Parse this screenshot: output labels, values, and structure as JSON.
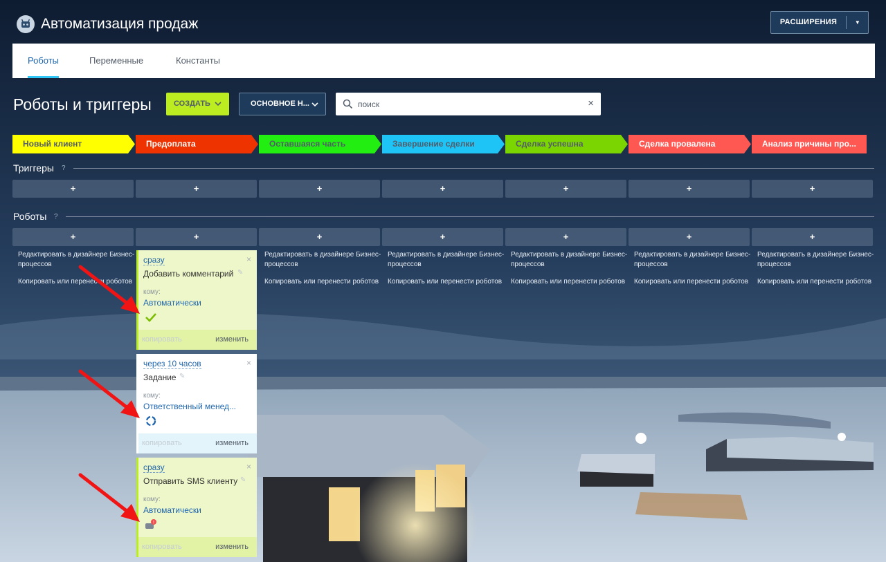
{
  "header": {
    "app_title": "Автоматизация продаж",
    "extensions_label": "РАСШИРЕНИЯ",
    "extensions_arrow": "▼"
  },
  "tabs": [
    {
      "label": "Роботы",
      "active": true
    },
    {
      "label": "Переменные",
      "active": false
    },
    {
      "label": "Константы",
      "active": false
    }
  ],
  "toolbar": {
    "page_title": "Роботы и триггеры",
    "create_label": "СОЗДАТЬ",
    "preset_label": "ОСНОВНОЕ Н...",
    "search_placeholder": "поиск",
    "search_clear": "×"
  },
  "stages": [
    {
      "label": "Новый клиент",
      "color": "#ffff00",
      "text_color": "#535c69"
    },
    {
      "label": "Предоплата",
      "color": "#ee3300",
      "text_color": "#ffffff"
    },
    {
      "label": "Оставшаяся часть",
      "color": "#22ee11",
      "text_color": "#535c69"
    },
    {
      "label": "Завершение сделки",
      "color": "#1ec4f6",
      "text_color": "#535c69"
    },
    {
      "label": "Сделка успешна",
      "color": "#7bd500",
      "text_color": "#535c69"
    },
    {
      "label": "Сделка провалена",
      "color": "#ff5752",
      "text_color": "#ffffff"
    },
    {
      "label": "Анализ причины про...",
      "color": "#ff5752",
      "text_color": "#ffffff"
    }
  ],
  "triggers": {
    "title": "Триггеры",
    "help": "?",
    "add_label": "+"
  },
  "robots": {
    "title": "Роботы",
    "help": "?",
    "add_label": "+",
    "edit_link": "Редактировать в дизайнере Бизнес-процессов",
    "copy_link": "Копировать или перенести роботов",
    "edit_link_short": "Редактировать в дизайнере Бизнес-\nпроцессов",
    "copy_link_short": "Копировать или перенести роботов"
  },
  "robot_cards": [
    {
      "when": "сразу",
      "name": "Добавить комментарий",
      "to_label": "кому:",
      "to_value": "Автоматически",
      "status": "done-check-icon",
      "copy_label": "копировать",
      "edit_label": "изменить",
      "close": "×"
    },
    {
      "when": "через 10 часов",
      "name": "Задание",
      "to_label": "кому:",
      "to_value": "Ответственный менед...",
      "status": "in-progress-icon",
      "copy_label": "копировать",
      "edit_label": "изменить",
      "close": "×"
    },
    {
      "when": "сразу",
      "name": "Отправить SMS клиенту",
      "to_label": "кому:",
      "to_value": "Автоматически",
      "status": "sms-error-icon",
      "copy_label": "копировать",
      "edit_label": "изменить",
      "close": "×"
    }
  ],
  "colors": {
    "accent_blue": "#2067b0",
    "create_green": "#bbed21",
    "annotation_red": "#f01414"
  }
}
